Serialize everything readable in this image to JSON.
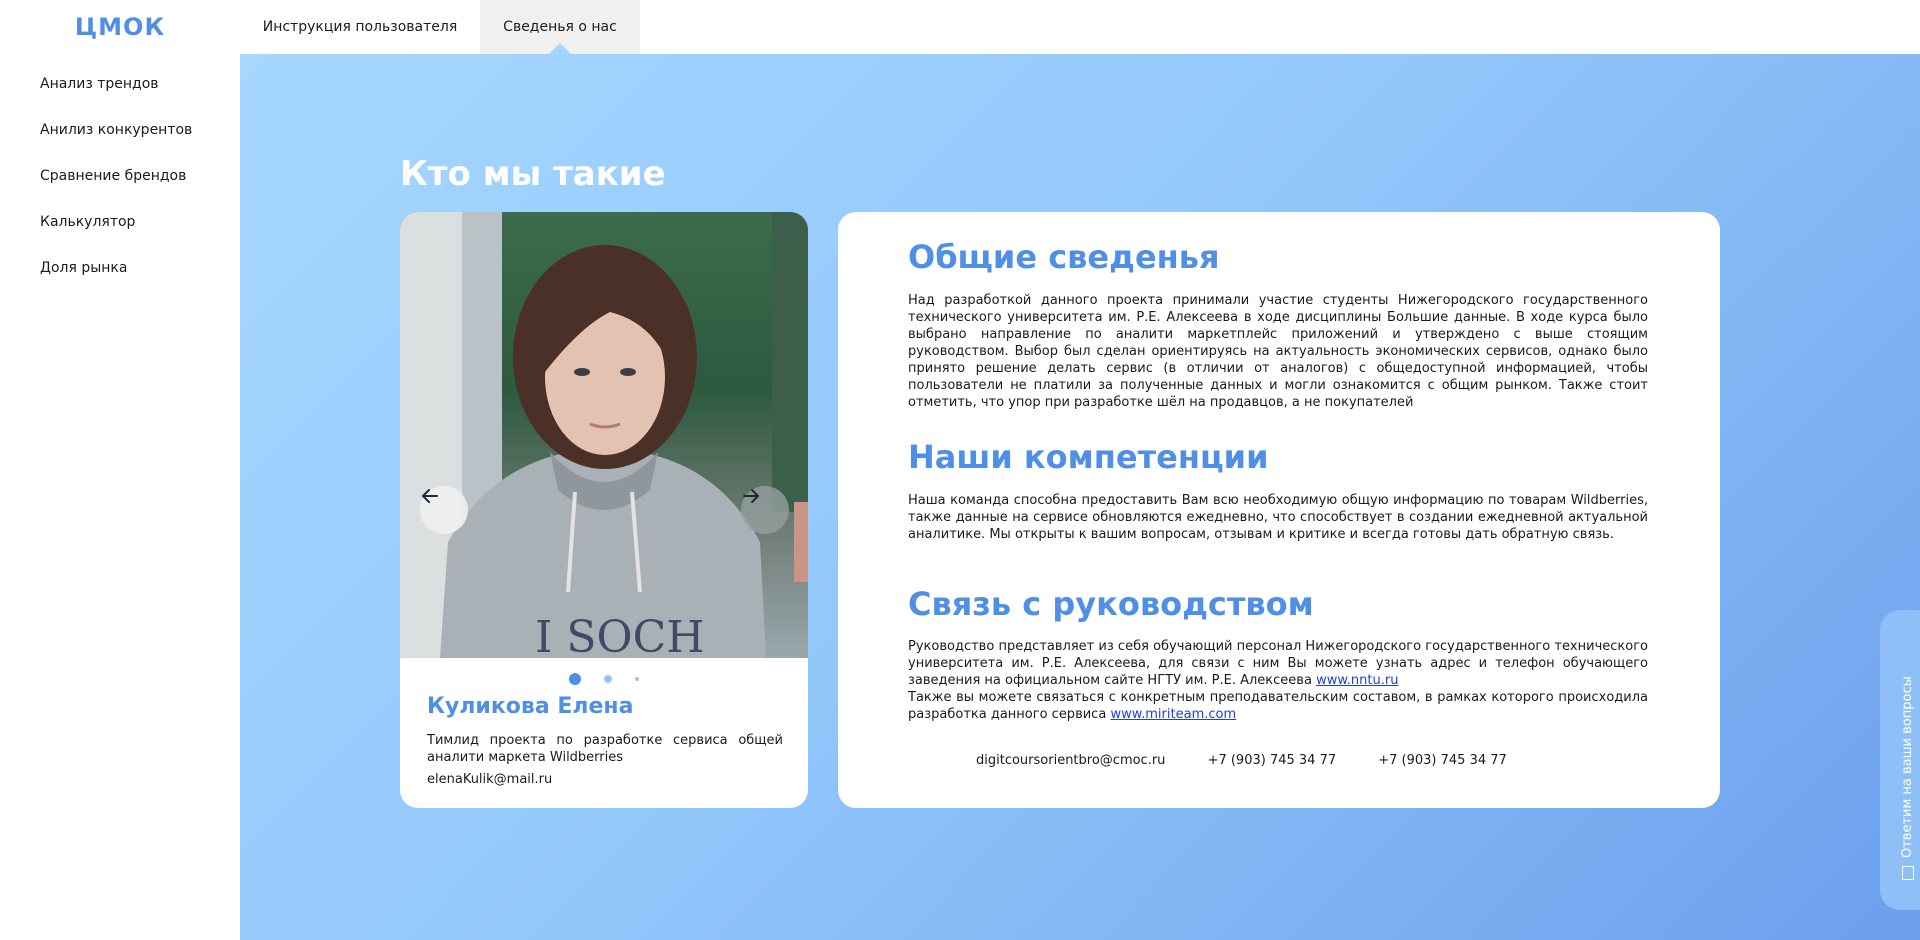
{
  "sidebar": {
    "logo": "ЦМОК",
    "items": [
      {
        "label": "Анализ трендов"
      },
      {
        "label": "Анилиз конкурентов"
      },
      {
        "label": "Сравнение брендов"
      },
      {
        "label": "Калькулятор"
      },
      {
        "label": "Доля рынка"
      }
    ]
  },
  "header": {
    "tabs": [
      {
        "label": "Инструкция пользователя",
        "active": false
      },
      {
        "label": "Сведенья о нас",
        "active": true
      }
    ]
  },
  "main": {
    "title": "Кто мы такие",
    "card": {
      "name": "Куликова Елена",
      "role": "Тимлид проекта по разработке сервиса общей аналити  маркета Wildberries",
      "email": "elenaKulik@mail.ru",
      "prev_icon": "arrow-left-icon",
      "next_icon": "arrow-right-icon",
      "photo_shirt_text": "I SOCH",
      "slides": 3,
      "active_slide": 1
    },
    "info": {
      "general": {
        "title": "Общие сведенья",
        "text": "Над разработкой данного проекта принимали участие студенты Нижегородского государственного технического университета им. Р.Е. Алексеева в ходе дисциплины Большие данные. В ходе курса было выбрано направление по аналити маркетплейс приложений и утверждено с выше стоящим руководством. Выбор был сделан ориентируясь на актуальность экономических сервисов, однако было принято решение делать сервис (в отличии от аналогов) с общедоступной информацией, чтобы пользователи не платили за полученные данных и могли ознакомится с общим рынком. Также стоит отметить, что упор при разработке шёл на продавцов, а не покупателей"
      },
      "competence": {
        "title": "Наши компетенции",
        "text": "Наша команда способна предоставить Вам всю необходимую общую информацию по товарам Wildberries, также данные на сервисе обновляются ежедневно, что способствует в создании ежедневной актуальной аналитике. Мы открыты к вашим вопросам, отзывам и критике и всегда готовы дать обратную связь."
      },
      "contact": {
        "title": "Связь с руководством",
        "text1": "Руководство представляет из себя обучающий персонал Нижегородского государственного технического университета им. Р.Е. Алексеева, для связи с ним Вы можете узнать адрес и телефон обучающего заведения на официальном сайте НГТУ им. Р.Е. Алексеева",
        "link1": "www.nntu.ru",
        "text2": "Также вы можете связаться с конкретным преподавательским составом, в рамках которого происходила разработка данного сервиса",
        "link2": "www.miriteam.com"
      },
      "contacts": {
        "email": "digitcoursorientbro@cmoc.ru",
        "phone1": "+7 (903) 745 34 77",
        "phone2": "+7 (903) 745 34 77"
      }
    }
  },
  "feedback": {
    "label": "Ответим на ваши вопросы",
    "icon": "mail-icon"
  },
  "colors": {
    "accent": "#4f8fe6",
    "gradient_start": "#a6d7ff",
    "gradient_end": "#6c9fec",
    "link": "#1e3fd6"
  }
}
